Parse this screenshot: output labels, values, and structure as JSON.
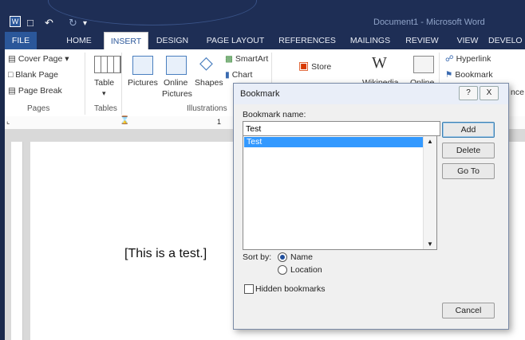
{
  "window": {
    "title": "Document1 - Microsoft Word"
  },
  "tabs": [
    "FILE",
    "HOME",
    "INSERT",
    "DESIGN",
    "PAGE LAYOUT",
    "REFERENCES",
    "MAILINGS",
    "REVIEW",
    "VIEW",
    "DEVELO"
  ],
  "ribbon": {
    "pages": {
      "cover_page": "Cover Page",
      "blank_page": "Blank Page",
      "page_break": "Page Break",
      "group": "Pages"
    },
    "tables": {
      "table": "Table",
      "group": "Tables"
    },
    "illustrations": {
      "pictures": "Pictures",
      "online_pictures_1": "Online",
      "online_pictures_2": "Pictures",
      "shapes": "Shapes",
      "smartart": "SmartArt",
      "chart": "Chart",
      "group": "Illustrations"
    },
    "apps": {
      "store": "Store",
      "wikipedia": "Wikipedia",
      "online": "Online"
    },
    "links": {
      "hyperlink": "Hyperlink",
      "bookmark": "Bookmark",
      "partial": "nce"
    },
    "ruler_mark": "1"
  },
  "document": {
    "text": "This is a test."
  },
  "dialog": {
    "title": "Bookmark",
    "help": "?",
    "close": "X",
    "name_label": "Bookmark name:",
    "name_value": "Test",
    "list_items": [
      "Test"
    ],
    "buttons": {
      "add": "Add",
      "delete": "Delete",
      "goto": "Go To",
      "cancel": "Cancel"
    },
    "sort_label": "Sort by:",
    "sort_name": "Name",
    "sort_location": "Location",
    "hidden": "Hidden bookmarks"
  }
}
